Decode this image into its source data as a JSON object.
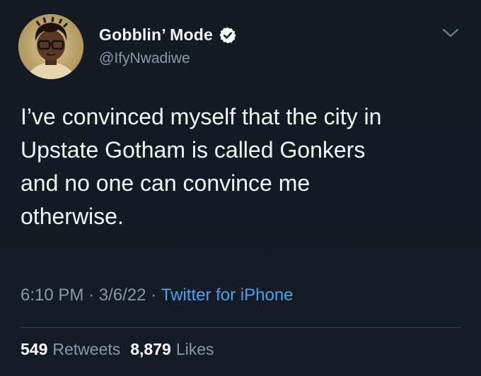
{
  "author": {
    "display_name": "Gobblin’ Mode",
    "handle": "@IfyNwadiwe",
    "verified": true,
    "avatar_icon": "avatar"
  },
  "tweet": {
    "text": "I’ve convinced myself that the city in\nUpstate Gotham is called Gonkers\nand no one can convince me\notherwise."
  },
  "meta": {
    "time": "6:10 PM",
    "sep1": " · ",
    "date": "3/6/22",
    "sep2": " · ",
    "source": "Twitter for iPhone"
  },
  "stats": {
    "retweets_count": "549",
    "retweets_label": "Retweets",
    "likes_count": "8,879",
    "likes_label": "Likes"
  },
  "colors": {
    "background": "#15202b",
    "link": "#4aa2ea",
    "secondary_text": "#8899a6",
    "verified_badge": "#ffffff"
  }
}
